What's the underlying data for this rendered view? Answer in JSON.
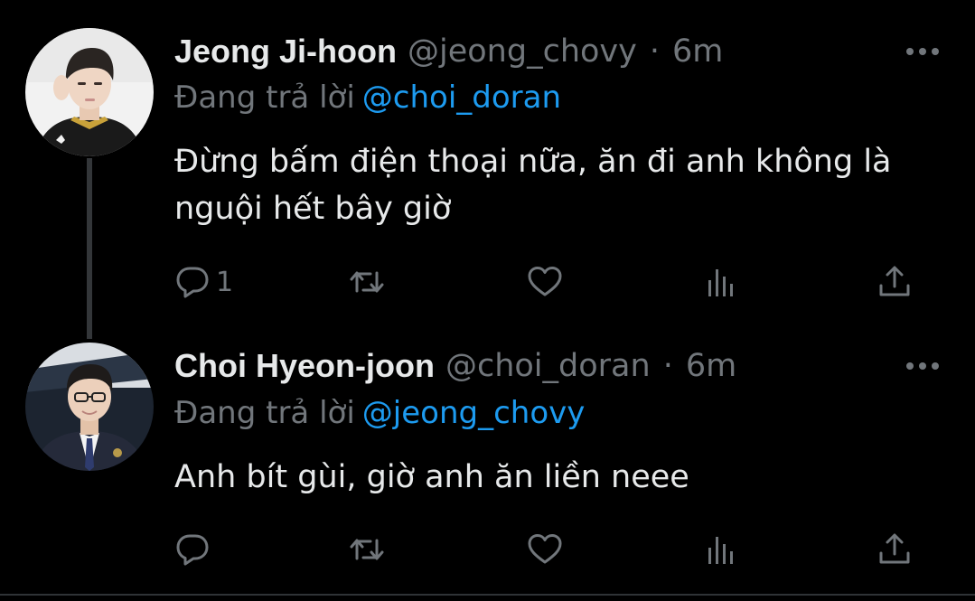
{
  "thread": [
    {
      "display_name": "Jeong Ji-hoon",
      "handle": "@jeong_chovy",
      "separator": "·",
      "time": "6m",
      "reply_label": "Đang trả lời",
      "reply_to": "@choi_doran",
      "text": "Đừng bấm điện thoại nữa, ăn đi anh không là nguội hết bây giờ",
      "reply_count": "1",
      "avatar_icon": "avatar-photo"
    },
    {
      "display_name": "Choi Hyeon-joon",
      "handle": "@choi_doran",
      "separator": "·",
      "time": "6m",
      "reply_label": "Đang trả lời",
      "reply_to": "@jeong_chovy",
      "text": "Anh bít gùi, giờ anh ăn liền neee",
      "reply_count": "",
      "avatar_icon": "avatar-photo"
    }
  ],
  "icons": {
    "reply": "speech-bubble-icon",
    "retweet": "retweet-icon",
    "like": "heart-icon",
    "views": "bar-chart-icon",
    "share": "share-icon",
    "more": "more-dots-icon"
  },
  "colors": {
    "background": "#000000",
    "text": "#e7e9ea",
    "muted": "#71767b",
    "link": "#1d9bf0",
    "thread_line": "#333639"
  }
}
